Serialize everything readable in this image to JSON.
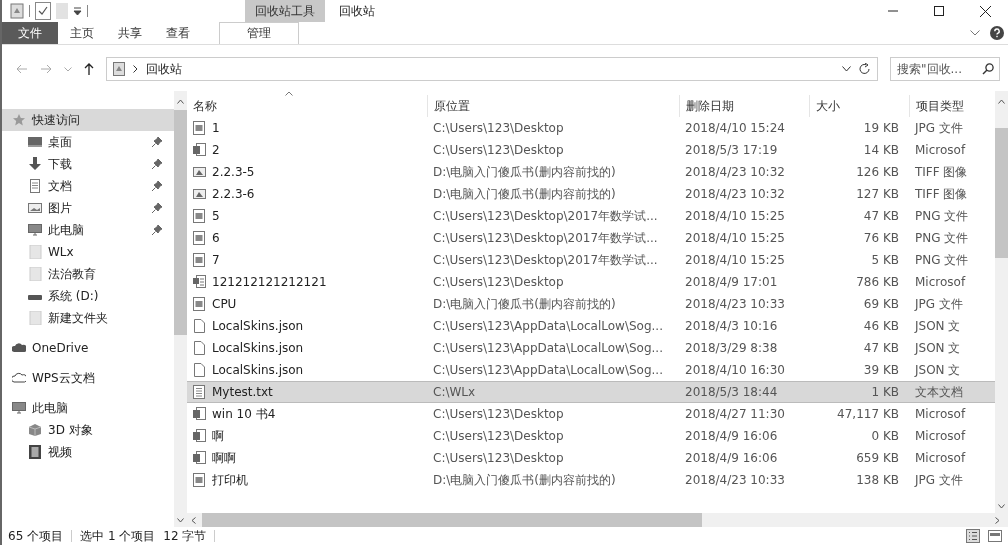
{
  "window": {
    "title": "回收站",
    "contextual_tab": "回收站工具"
  },
  "ribbon_tabs": [
    {
      "label": "文件",
      "kind": "file",
      "selected": false
    },
    {
      "label": "主页",
      "kind": "tab",
      "selected": false
    },
    {
      "label": "共享",
      "kind": "tab",
      "selected": false
    },
    {
      "label": "查看",
      "kind": "tab",
      "selected": false
    },
    {
      "label": "管理",
      "kind": "tab",
      "selected": true
    }
  ],
  "address_bar": {
    "path": "回收站",
    "search_placeholder": "搜索\"回收..."
  },
  "sidebar": {
    "items": [
      {
        "label": "快速访问",
        "kind": "star",
        "pinned": false,
        "selected": true,
        "children": [
          {
            "label": "桌面",
            "kind": "desktop",
            "pinned": true,
            "selected": false
          },
          {
            "label": "下载",
            "kind": "download",
            "pinned": true,
            "selected": false
          },
          {
            "label": "文档",
            "kind": "document",
            "pinned": true,
            "selected": false
          },
          {
            "label": "图片",
            "kind": "picture",
            "pinned": true,
            "selected": false
          },
          {
            "label": "此电脑",
            "kind": "computer",
            "pinned": true,
            "selected": false
          },
          {
            "label": "WLx",
            "kind": "folder",
            "pinned": false,
            "selected": false
          },
          {
            "label": "法治教育",
            "kind": "folder",
            "pinned": false,
            "selected": false
          },
          {
            "label": "系统 (D:)",
            "kind": "drive",
            "pinned": false,
            "selected": false
          },
          {
            "label": "新建文件夹",
            "kind": "folder",
            "pinned": false,
            "selected": false
          }
        ]
      },
      {
        "label": "OneDrive",
        "kind": "cloud",
        "pinned": false,
        "selected": false
      },
      {
        "label": "WPS云文档",
        "kind": "cloud-outline",
        "pinned": false,
        "selected": false
      },
      {
        "label": "此电脑",
        "kind": "computer",
        "pinned": false,
        "selected": false,
        "children": [
          {
            "label": "3D 对象",
            "kind": "cube",
            "pinned": false,
            "selected": false
          },
          {
            "label": "视频",
            "kind": "video",
            "pinned": false,
            "selected": false
          }
        ]
      }
    ]
  },
  "table": {
    "columns": [
      "名称",
      "原位置",
      "删除日期",
      "大小",
      "项目类型"
    ],
    "rows": [
      {
        "kind": "image",
        "selected": false,
        "cells": [
          "1",
          "C:\\Users\\123\\Desktop",
          "2018/4/10 15:24",
          "19 KB",
          "JPG 文件"
        ]
      },
      {
        "kind": "word",
        "selected": false,
        "cells": [
          "2",
          "C:\\Users\\123\\Desktop",
          "2018/5/3 17:19",
          "14 KB",
          "Microsof"
        ]
      },
      {
        "kind": "tiff",
        "selected": false,
        "cells": [
          "2.2.3-5",
          "D:\\电脑入门傻瓜书(删内容前找的)",
          "2018/4/23 10:32",
          "126 KB",
          "TIFF 图像"
        ]
      },
      {
        "kind": "tiff",
        "selected": false,
        "cells": [
          "2.2.3-6",
          "D:\\电脑入门傻瓜书(删内容前找的)",
          "2018/4/23 10:32",
          "127 KB",
          "TIFF 图像"
        ]
      },
      {
        "kind": "image",
        "selected": false,
        "cells": [
          "5",
          "C:\\Users\\123\\Desktop\\2017年数学试...",
          "2018/4/10 15:25",
          "47 KB",
          "PNG 文件"
        ]
      },
      {
        "kind": "image",
        "selected": false,
        "cells": [
          "6",
          "C:\\Users\\123\\Desktop\\2017年数学试...",
          "2018/4/10 15:25",
          "76 KB",
          "PNG 文件"
        ]
      },
      {
        "kind": "image",
        "selected": false,
        "cells": [
          "7",
          "C:\\Users\\123\\Desktop\\2017年数学试...",
          "2018/4/10 15:25",
          "5 KB",
          "PNG 文件"
        ]
      },
      {
        "kind": "word-doc",
        "selected": false,
        "cells": [
          "121212121212121",
          "C:\\Users\\123\\Desktop",
          "2018/4/9 17:01",
          "786 KB",
          "Microsof"
        ]
      },
      {
        "kind": "image",
        "selected": false,
        "cells": [
          "CPU",
          "D:\\电脑入门傻瓜书(删内容前找的)",
          "2018/4/23 10:33",
          "69 KB",
          "JPG 文件"
        ]
      },
      {
        "kind": "blank",
        "selected": false,
        "cells": [
          "LocalSkins.json",
          "C:\\Users\\123\\AppData\\LocalLow\\Sog...",
          "2018/4/3 10:16",
          "46 KB",
          "JSON 文"
        ]
      },
      {
        "kind": "blank",
        "selected": false,
        "cells": [
          "LocalSkins.json",
          "C:\\Users\\123\\AppData\\LocalLow\\Sog...",
          "2018/3/29 8:38",
          "47 KB",
          "JSON 文"
        ]
      },
      {
        "kind": "blank",
        "selected": false,
        "cells": [
          "LocalSkins.json",
          "C:\\Users\\123\\AppData\\LocalLow\\Sog...",
          "2018/4/10 16:30",
          "39 KB",
          "JSON 文"
        ]
      },
      {
        "kind": "text",
        "selected": true,
        "cells": [
          "Mytest.txt",
          "C:\\WLx",
          "2018/5/3 18:44",
          "1 KB",
          "文本文档"
        ]
      },
      {
        "kind": "word",
        "selected": false,
        "cells": [
          "win 10 书4",
          "C:\\Users\\123\\Desktop",
          "2018/4/27 11:30",
          "47,117 KB",
          "Microsof"
        ]
      },
      {
        "kind": "word",
        "selected": false,
        "cells": [
          "啊",
          "C:\\Users\\123\\Desktop",
          "2018/4/9 16:06",
          "0 KB",
          "Microsof"
        ]
      },
      {
        "kind": "word",
        "selected": false,
        "cells": [
          "啊啊",
          "C:\\Users\\123\\Desktop",
          "2018/4/9 16:06",
          "659 KB",
          "Microsof"
        ]
      },
      {
        "kind": "image",
        "selected": false,
        "cells": [
          "打印机",
          "D:\\电脑入门傻瓜书(删内容前找的)",
          "2018/4/23 10:33",
          "138 KB",
          "JPG 文件"
        ]
      }
    ]
  },
  "status_bar": {
    "item_count": "65 个项目",
    "selection": "选中 1 个项目",
    "size": "12 字节"
  }
}
